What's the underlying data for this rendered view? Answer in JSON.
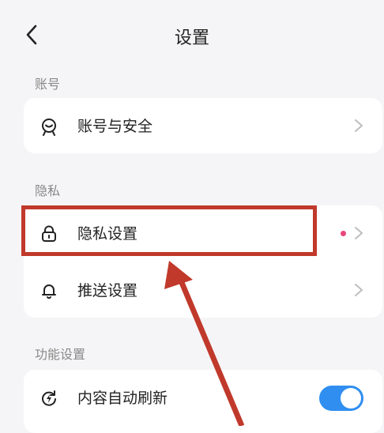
{
  "header": {
    "title": "设置",
    "back_icon": "chevron-left-icon"
  },
  "sections": {
    "account": {
      "label": "账号",
      "items": [
        {
          "label": "账号与安全",
          "icon": "account-security-icon"
        }
      ]
    },
    "privacy": {
      "label": "隐私",
      "items": [
        {
          "label": "隐私设置",
          "icon": "lock-icon",
          "has_dot": true,
          "highlighted": true
        },
        {
          "label": "推送设置",
          "icon": "bell-icon"
        }
      ]
    },
    "features": {
      "label": "功能设置",
      "items": [
        {
          "label": "内容自动刷新",
          "icon": "refresh-icon",
          "toggle": true
        }
      ]
    }
  },
  "colors": {
    "background": "#f5f5f7",
    "card": "#ffffff",
    "toggle_on": "#2f8ef0",
    "notification_dot": "#e8477a",
    "annotation": "#c0392b"
  }
}
